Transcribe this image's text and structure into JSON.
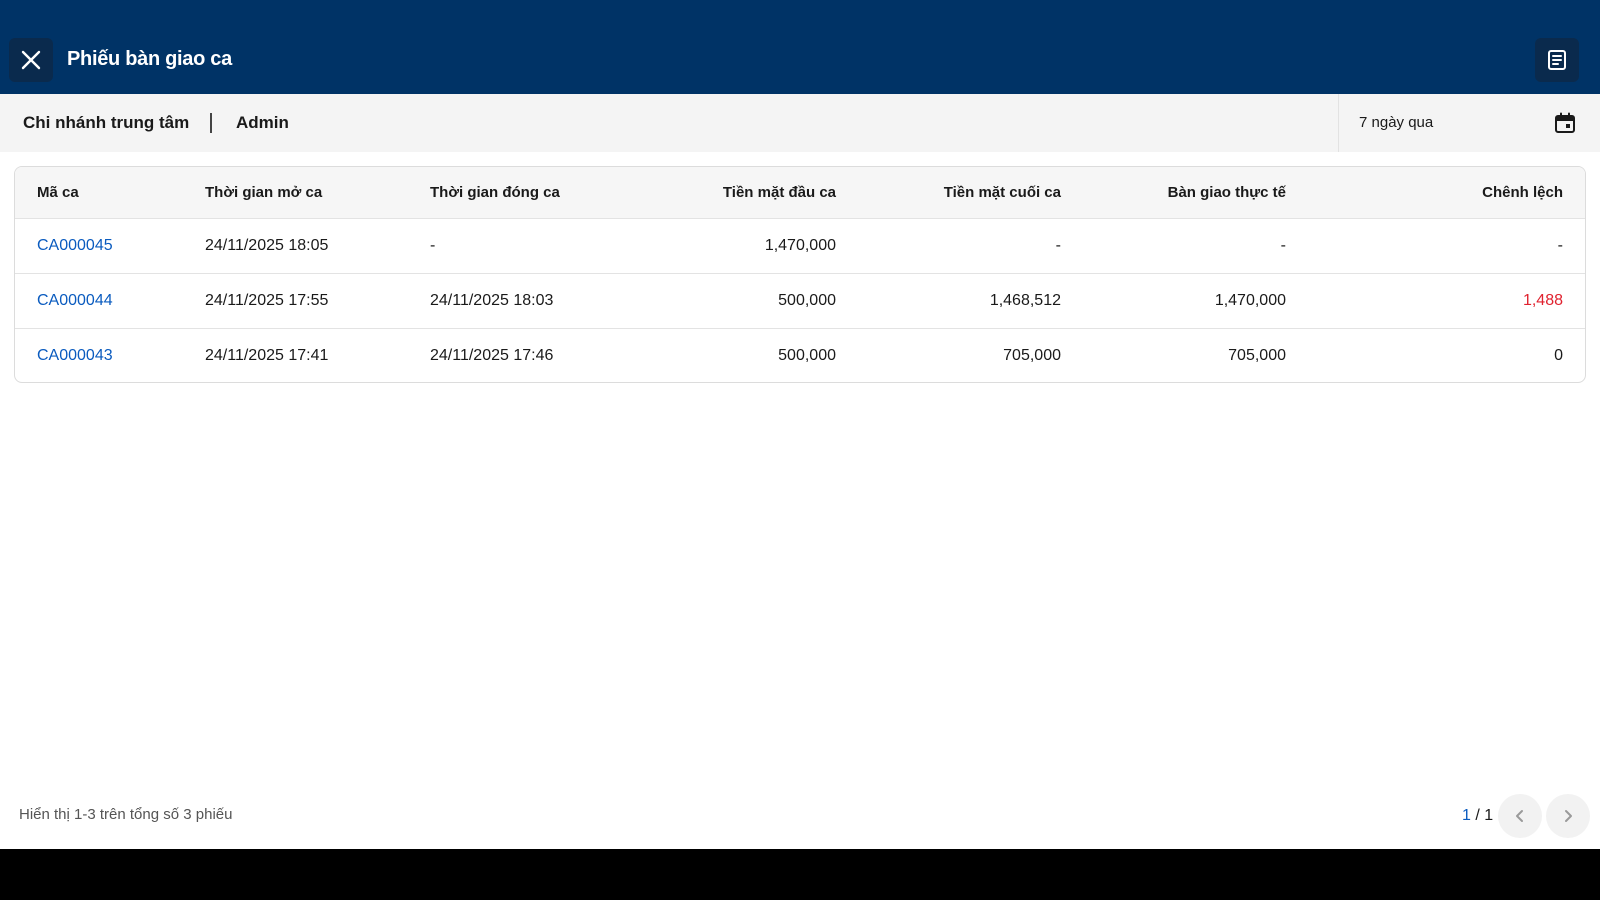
{
  "header": {
    "title": "Phiếu bàn giao ca",
    "close_icon": "close-icon",
    "report_icon": "receipt-icon"
  },
  "filters": {
    "branch": "Chi nhánh trung tâm",
    "user": "Admin",
    "date_range": "7 ngày qua",
    "date_icon": "calendar-icon"
  },
  "table": {
    "columns": [
      "Mã ca",
      "Thời gian mở ca",
      "Thời gian đóng ca",
      "Tiền mặt đầu ca",
      "Tiền mặt cuối ca",
      "Bàn giao thực tế",
      "Chênh lệch"
    ],
    "rows": [
      {
        "code": "CA000045",
        "open": "24/11/2025 18:05",
        "close": "-",
        "cash_start": "1,470,000",
        "cash_end": "-",
        "handover": "-",
        "diff": "-"
      },
      {
        "code": "CA000044",
        "open": "24/11/2025 17:55",
        "close": "24/11/2025 18:03",
        "cash_start": "500,000",
        "cash_end": "1,468,512",
        "handover": "1,470,000",
        "diff": "1,488"
      },
      {
        "code": "CA000043",
        "open": "24/11/2025 17:41",
        "close": "24/11/2025 17:46",
        "cash_start": "500,000",
        "cash_end": "705,000",
        "handover": "705,000",
        "diff": "0"
      }
    ]
  },
  "footer": {
    "summary": "Hiển thị 1-3 trên tổng số 3 phiếu",
    "current_page": "1",
    "page_sep": " / ",
    "total_pages": "1"
  },
  "colors": {
    "header_bg": "#003366",
    "link": "#0a5bbf",
    "negative": "#e0222f"
  }
}
